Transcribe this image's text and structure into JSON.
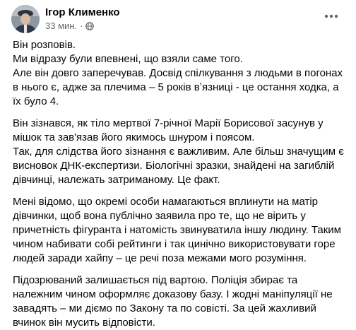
{
  "post": {
    "author": "Ігор Клименко",
    "time": "33 мин.",
    "separator": "·",
    "privacy_icon": "globe-icon",
    "more_icon": "more-horizontal-icon",
    "paragraphs": [
      {
        "lines": [
          "Він розповів.",
          "Ми відразу були впевнені, що взяли саме того.",
          "Але він довго заперечував. Досвід спілкування з людьми в погонах",
          "в нього є, адже за плечима – 5 років вʼязниці - це остання ходка, а",
          "їх було 4."
        ]
      },
      {
        "lines": [
          "Він зізнався, як тіло мертвої 7-річної Марії Борисової засунув у",
          "мішок та зав'язав його якимось шнуром і поясом.",
          "Так, для слідства його зізнання є важливим. Але більш значущим є",
          "висновок ДНК-експертизи. Біологічні зразки, знайдені на загиблій",
          "дівчинці, належать затриманому. Це факт."
        ]
      },
      {
        "lines": [
          "Мені відомо, що окремі особи намагаються вплинути на матір",
          "дівчинки, щоб вона публічно заявила про те, що не вірить у",
          "причетність фігуранта і натомість звинуватила іншу людину. Таким",
          "чином набивати собі рейтинги і так цинічно використовувати горе",
          "людей заради хайпу – це речі поза межами мого розуміння."
        ]
      },
      {
        "lines": [
          "Підозрюваний залишається під вартою. Поліція збирає та",
          "належним чином оформляє доказову базу. І жодні маніпуляції не",
          "завадять – ми діємо по Закону та по совісті. За цей жахливий",
          "вчинок він мусить відповісти."
        ]
      }
    ]
  }
}
